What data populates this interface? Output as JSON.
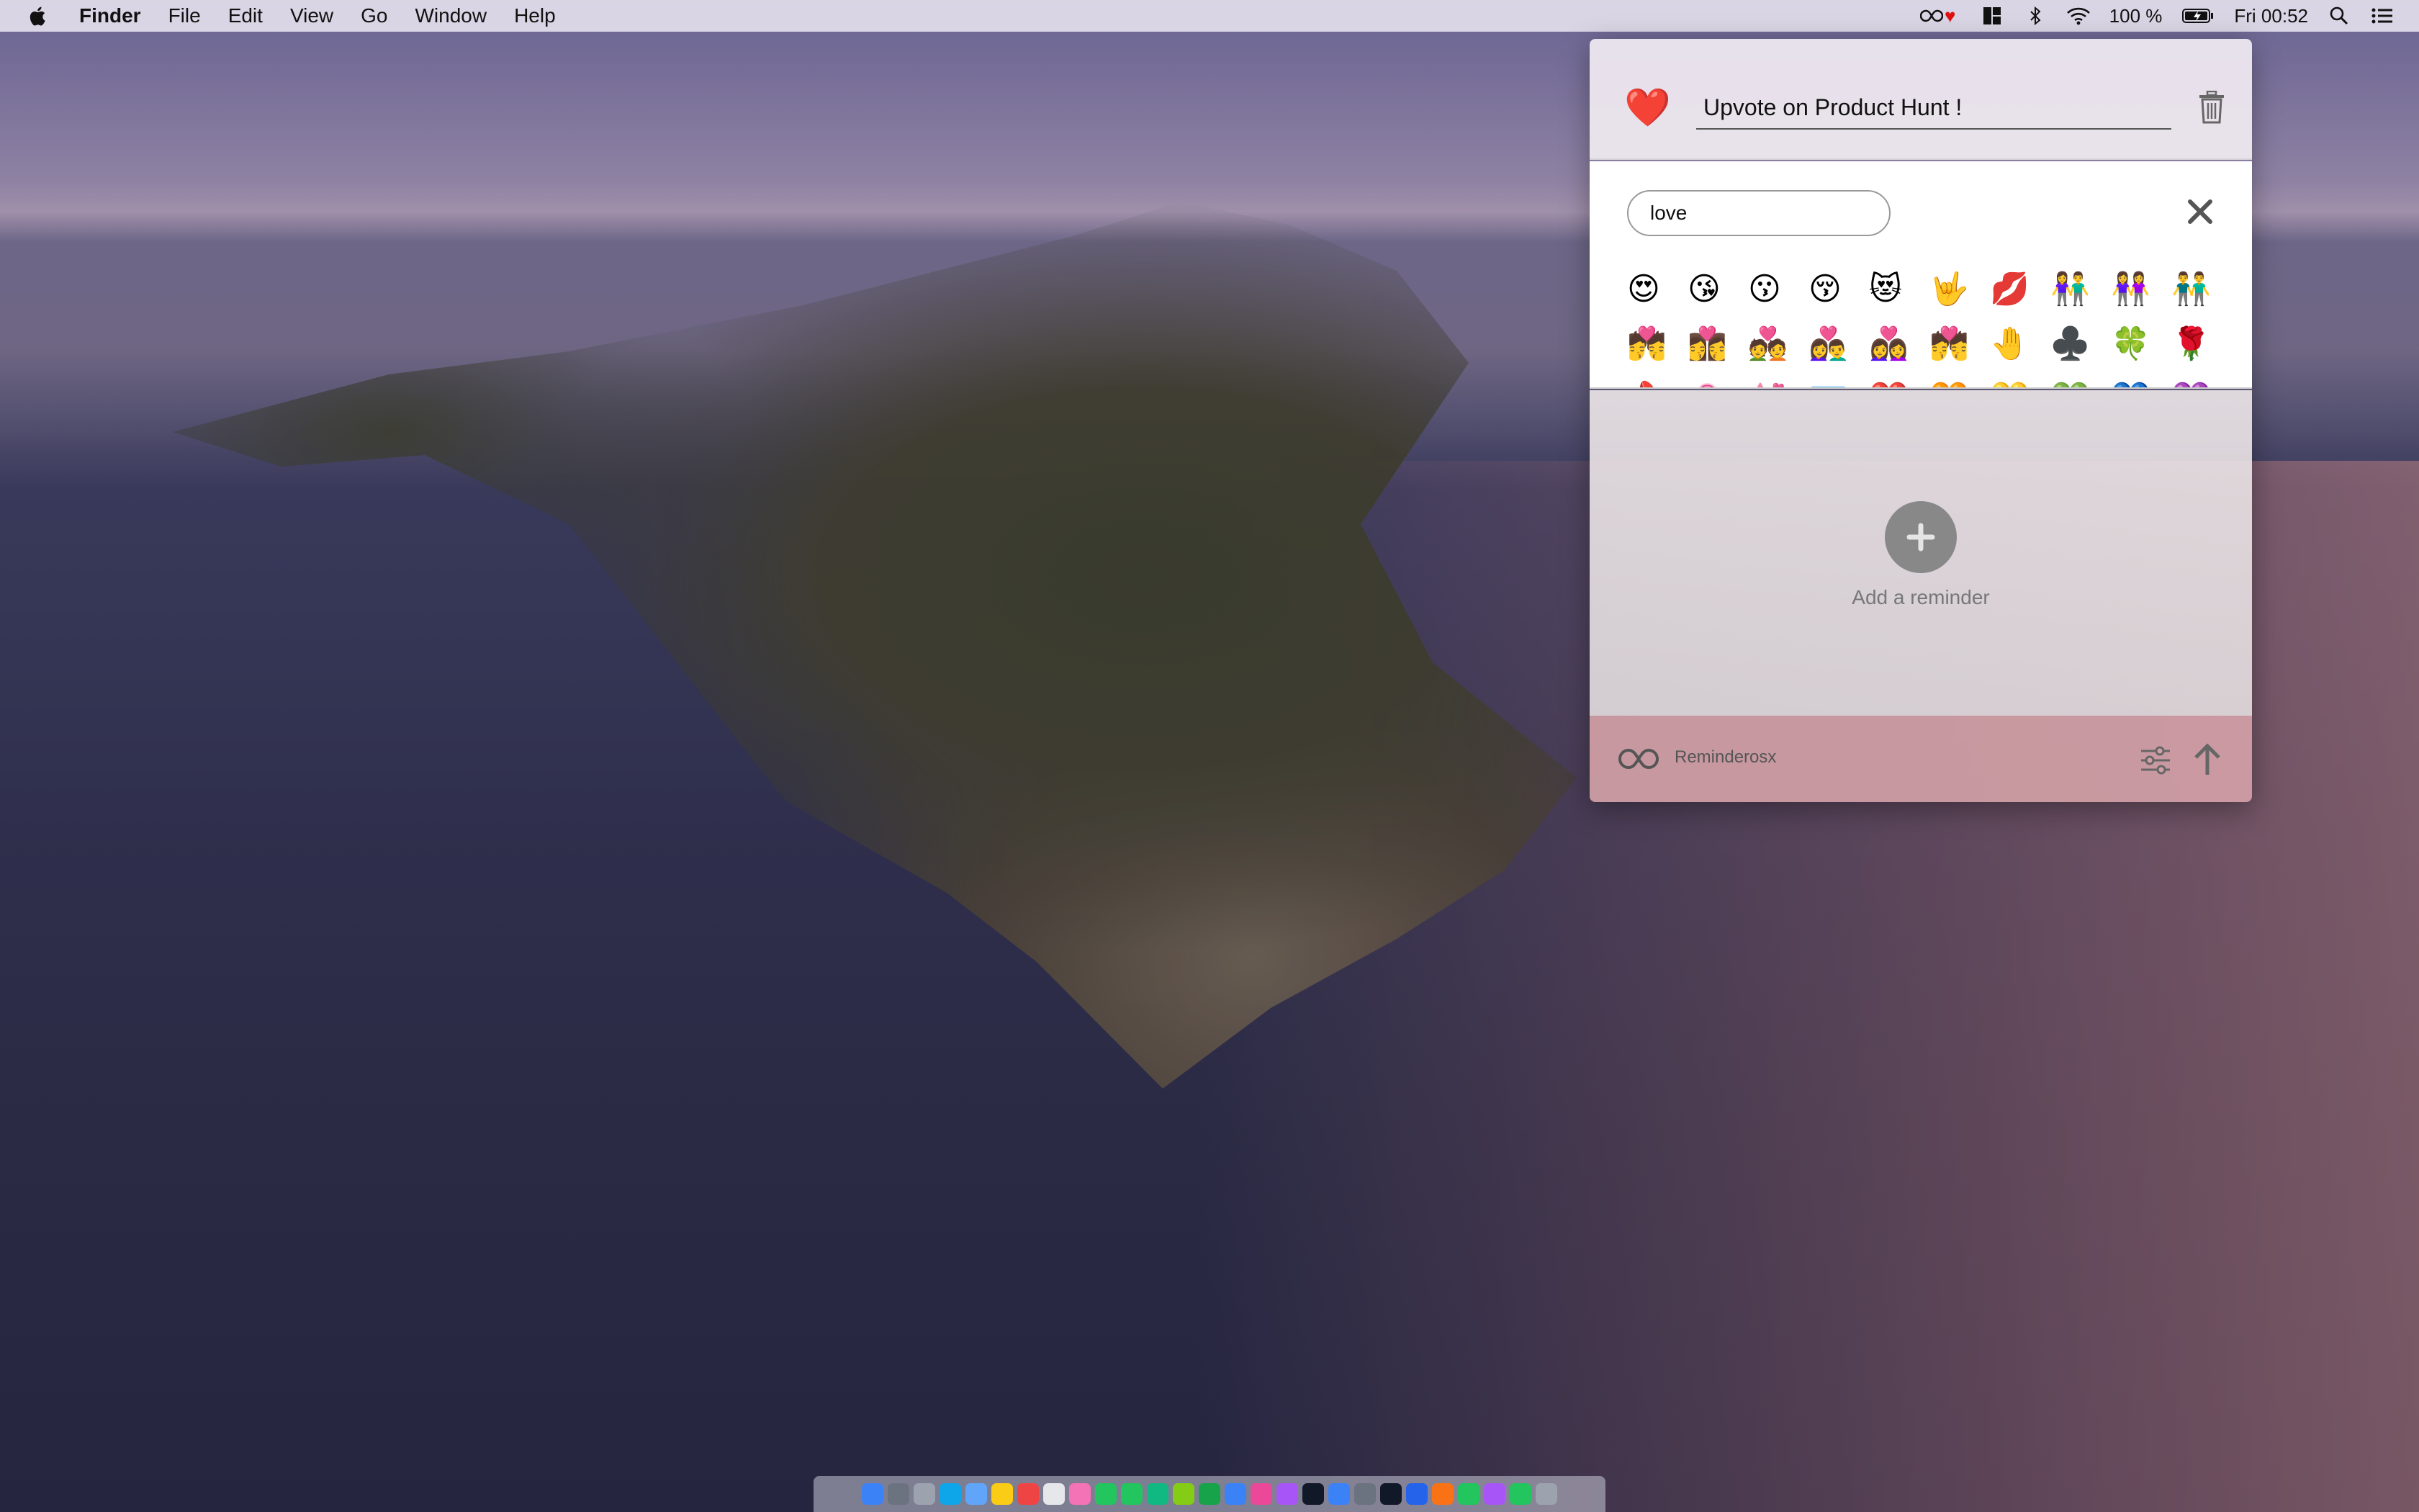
{
  "menubar": {
    "app_name": "Finder",
    "items": [
      "File",
      "Edit",
      "View",
      "Go",
      "Window",
      "Help"
    ],
    "status": {
      "battery_percent": "100 %",
      "clock": "Fri 00:52"
    }
  },
  "reminder": {
    "heart_emoji": "❤️",
    "title_value": "Upvote on Product Hunt !"
  },
  "emoji_picker": {
    "search_value": "love",
    "results": [
      "😍",
      "😘",
      "😗",
      "😚",
      "😻",
      "🤟",
      "💋",
      "👫",
      "👭",
      "👬",
      "💏",
      "👩‍❤️‍💋‍👩",
      "💑",
      "👩‍❤️‍👨",
      "👩‍❤️‍👩",
      "💏",
      "🤚",
      "♣️",
      "🍀",
      "🌹",
      "💄",
      "🏩",
      "💒",
      "💌",
      "❤️",
      "🧡",
      "💛",
      "💚",
      "💙",
      "💜"
    ]
  },
  "empty_state": {
    "add_label": "Add a reminder"
  },
  "footer": {
    "app_name": "Reminderosx"
  },
  "dock": {
    "icons": [
      "finder",
      "launchpad",
      "rocket",
      "safari",
      "preview",
      "notes",
      "calendar",
      "textedit",
      "photos",
      "chrome",
      "messages",
      "facetime",
      "maps",
      "numbers",
      "keynote",
      "music",
      "podcasts",
      "tv",
      "appstore",
      "preferences",
      "terminal",
      "vscode",
      "sublime",
      "chrome2",
      "slack",
      "whatsapp",
      "trash"
    ],
    "colors": [
      "#3b82f6",
      "#6b7280",
      "#9ca3af",
      "#0ea5e9",
      "#60a5fa",
      "#facc15",
      "#ef4444",
      "#e5e7eb",
      "#f472b6",
      "#22c55e",
      "#22c55e",
      "#10b981",
      "#84cc16",
      "#16a34a",
      "#3b82f6",
      "#ec4899",
      "#a855f7",
      "#111827",
      "#3b82f6",
      "#6b7280",
      "#111827",
      "#2563eb",
      "#f97316",
      "#22c55e",
      "#a855f7",
      "#22c55e",
      "#9ca3af"
    ]
  }
}
